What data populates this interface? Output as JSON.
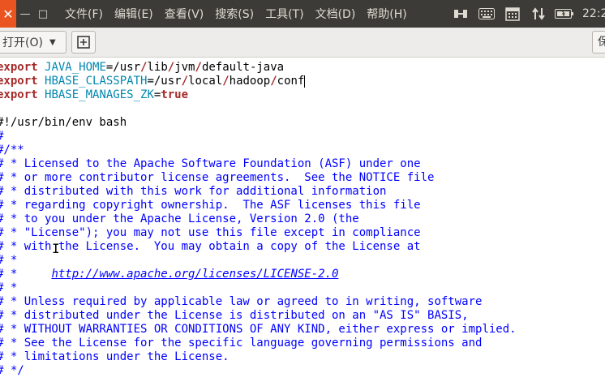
{
  "window": {
    "close_glyph": "✕",
    "minimize_glyph": "—",
    "maximize_glyph": "□"
  },
  "menubar": {
    "items": [
      "文件(F)",
      "编辑(E)",
      "查看(V)",
      "搜索(S)",
      "工具(T)",
      "文档(D)",
      "帮助(H)"
    ]
  },
  "tray": {
    "icons": [
      "input-method-icon",
      "keyboard-icon",
      "calendar-icon",
      "network-icon",
      "battery-icon"
    ],
    "clock": "22:2"
  },
  "toolbar": {
    "open_label": "打开(O)",
    "save_label": "保"
  },
  "editor": {
    "lines": [
      [
        {
          "c": "kw",
          "t": "export"
        },
        {
          "c": "",
          "t": " "
        },
        {
          "c": "var",
          "t": "JAVA_HOME"
        },
        {
          "c": "",
          "t": "=/usr"
        },
        {
          "c": "sl",
          "t": "/"
        },
        {
          "c": "",
          "t": "lib"
        },
        {
          "c": "sl",
          "t": "/"
        },
        {
          "c": "",
          "t": "jvm"
        },
        {
          "c": "sl",
          "t": "/"
        },
        {
          "c": "",
          "t": "default-java"
        }
      ],
      [
        {
          "c": "kw",
          "t": "export"
        },
        {
          "c": "",
          "t": " "
        },
        {
          "c": "var",
          "t": "HBASE_CLASSPATH"
        },
        {
          "c": "",
          "t": "=/usr"
        },
        {
          "c": "sl",
          "t": "/"
        },
        {
          "c": "",
          "t": "local"
        },
        {
          "c": "sl",
          "t": "/"
        },
        {
          "c": "",
          "t": "hadoop"
        },
        {
          "c": "sl",
          "t": "/"
        },
        {
          "c": "",
          "t": "conf"
        },
        {
          "c": "cursor",
          "t": ""
        }
      ],
      [
        {
          "c": "kw",
          "t": "export"
        },
        {
          "c": "",
          "t": " "
        },
        {
          "c": "var",
          "t": "HBASE_MANAGES_ZK"
        },
        {
          "c": "",
          "t": "="
        },
        {
          "c": "tr",
          "t": "true"
        }
      ],
      [],
      [
        {
          "c": "",
          "t": "#!/usr/bin/env bash"
        }
      ],
      [
        {
          "c": "cm",
          "t": "#"
        }
      ],
      [
        {
          "c": "cm",
          "t": "#/**"
        }
      ],
      [
        {
          "c": "cm",
          "t": "# * Licensed to the Apache Software Foundation (ASF) under one"
        }
      ],
      [
        {
          "c": "cm",
          "t": "# * or more contributor license agreements.  See the NOTICE file"
        }
      ],
      [
        {
          "c": "cm",
          "t": "# * distributed with this work for additional information"
        }
      ],
      [
        {
          "c": "cm",
          "t": "# * regarding copyright ownership.  The ASF licenses this file"
        }
      ],
      [
        {
          "c": "cm",
          "t": "# * to you under the Apache License, Version 2.0 (the"
        }
      ],
      [
        {
          "c": "cm",
          "t": "# * \"License\"); you may not use this file except in compliance"
        }
      ],
      [
        {
          "c": "cm",
          "t": "# * with the License.  You may obtain a copy of the License at"
        }
      ],
      [
        {
          "c": "cm",
          "t": "# *"
        }
      ],
      [
        {
          "c": "cm",
          "t": "# *     "
        },
        {
          "c": "url",
          "t": "http://www.apache.org/licenses/LICENSE-2.0"
        }
      ],
      [
        {
          "c": "cm",
          "t": "# *"
        }
      ],
      [
        {
          "c": "cm",
          "t": "# * Unless required by applicable law or agreed to in writing, software"
        }
      ],
      [
        {
          "c": "cm",
          "t": "# * distributed under the License is distributed on an \"AS IS\" BASIS,"
        }
      ],
      [
        {
          "c": "cm",
          "t": "# * WITHOUT WARRANTIES OR CONDITIONS OF ANY KIND, either express or implied."
        }
      ],
      [
        {
          "c": "cm",
          "t": "# * See the License for the specific language governing permissions and"
        }
      ],
      [
        {
          "c": "cm",
          "t": "# * limitations under the License."
        }
      ],
      [
        {
          "c": "cm",
          "t": "# */"
        }
      ]
    ]
  }
}
